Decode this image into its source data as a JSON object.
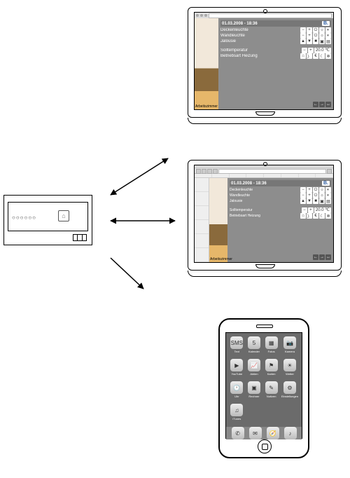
{
  "controller": {
    "leds_glyph": "○○○○○○",
    "home_glyph": "⌂"
  },
  "app": {
    "timestamp": "01.03.2008 - 18:36",
    "brand": "B.",
    "thumb_caption": "Arbeitszimmer",
    "rows": [
      {
        "label": "Deckenleuchte",
        "buttons": [
          "−",
          "+",
          "⏻",
          "☼",
          "◐"
        ]
      },
      {
        "label": "Wandleuchte",
        "buttons": [
          "−",
          "+",
          "⏻",
          "☼",
          "◐"
        ]
      },
      {
        "label": "Jalousie",
        "buttons": [
          "▲",
          "▼",
          "■",
          "▣",
          "▤"
        ]
      }
    ],
    "rows2": [
      {
        "label": "Solltemperatur",
        "buttons": [
          "−",
          "+"
        ],
        "value": "20.0 ℃"
      },
      {
        "label": "Betriebsart Heizung",
        "buttons": [
          "⌂",
          "〉",
          "€",
          "☾",
          "❄"
        ]
      }
    ],
    "nav": [
      "←",
      "→",
      "↔"
    ]
  },
  "phone": {
    "apps": [
      {
        "glyph": "SMS",
        "label": "Text"
      },
      {
        "glyph": "5",
        "label": "Kalender"
      },
      {
        "glyph": "▦",
        "label": "Fotos"
      },
      {
        "glyph": "📷",
        "label": "Kamera"
      },
      {
        "glyph": "▶",
        "label": "YouTube"
      },
      {
        "glyph": "📈",
        "label": "Aktien"
      },
      {
        "glyph": "⚑",
        "label": "Karten"
      },
      {
        "glyph": "☀",
        "label": "Wetter"
      },
      {
        "glyph": "🕐",
        "label": "Uhr"
      },
      {
        "glyph": "▣",
        "label": "Rechner"
      },
      {
        "glyph": "✎",
        "label": "Notizen"
      },
      {
        "glyph": "⚙",
        "label": "Einstellungen"
      },
      {
        "glyph": "♫",
        "label": "iTunes"
      },
      {
        "glyph": "",
        "label": ""
      },
      {
        "glyph": "",
        "label": ""
      },
      {
        "glyph": "",
        "label": ""
      }
    ],
    "dock": [
      {
        "glyph": "✆"
      },
      {
        "glyph": "✉"
      },
      {
        "glyph": "🧭"
      },
      {
        "glyph": "♪"
      }
    ]
  }
}
